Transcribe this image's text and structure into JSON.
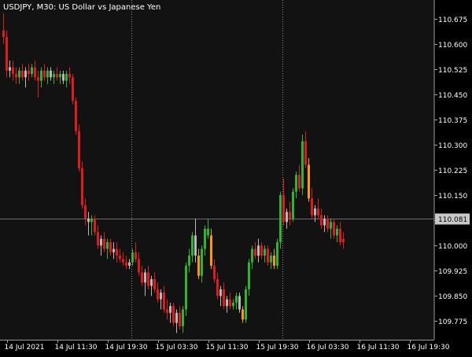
{
  "chart_data": {
    "type": "candlestick",
    "symbol": "USDJPY",
    "timeframe": "M30",
    "description": "US Dollar vs Japanese Yen",
    "current_price": "110.081",
    "current_price_value": 110.081,
    "ylim": [
      109.72,
      110.73
    ],
    "y_ticks": [
      "110.675",
      "110.600",
      "110.525",
      "110.450",
      "110.375",
      "110.300",
      "110.225",
      "110.150",
      "110.075",
      "110.000",
      "109.925",
      "109.850",
      "109.775"
    ],
    "y_tick_values": [
      110.675,
      110.6,
      110.525,
      110.45,
      110.375,
      110.3,
      110.225,
      110.15,
      110.075,
      110.0,
      109.925,
      109.85,
      109.775
    ],
    "x_ticks": [
      "14 Jul 2021",
      "14 Jul 11:30",
      "14 Jul 19:30",
      "15 Jul 03:30",
      "15 Jul 11:30",
      "15 Jul 19:30",
      "16 Jul 03:30",
      "16 Jul 11:30",
      "16 Jul 19:30"
    ],
    "x_tick_bars": [
      1,
      17,
      33,
      49,
      65,
      81,
      97,
      113,
      129
    ],
    "day_separators_at_bar": [
      40.5,
      88.5
    ],
    "colors": {
      "background": "#121212",
      "axis_bg": "#000000",
      "text": "#ffffff",
      "separator": "#8c8c8c",
      "price_line": "#8c8c8c",
      "bull": "#2fb52b",
      "bear": "#e01b1b",
      "neutral": "#b8b8b8",
      "highlight": "#ff9900",
      "price_box_bg": "#c8c8c8",
      "price_box_text": "#000000"
    },
    "candles": [
      [
        110.64,
        110.69,
        110.6,
        110.62,
        "bear"
      ],
      [
        110.62,
        110.64,
        110.5,
        110.52,
        "bear"
      ],
      [
        110.52,
        110.55,
        110.5,
        110.53,
        "neutral"
      ],
      [
        110.53,
        110.55,
        110.49,
        110.51,
        "bear"
      ],
      [
        110.51,
        110.53,
        110.48,
        110.5,
        "bear"
      ],
      [
        110.5,
        110.53,
        110.48,
        110.52,
        "bull"
      ],
      [
        110.52,
        110.54,
        110.49,
        110.5,
        "bear"
      ],
      [
        110.5,
        110.53,
        110.47,
        110.52,
        "neutral"
      ],
      [
        110.52,
        110.54,
        110.49,
        110.51,
        "bear"
      ],
      [
        110.51,
        110.54,
        110.5,
        110.53,
        "bull"
      ],
      [
        110.53,
        110.55,
        110.49,
        110.5,
        "bear"
      ],
      [
        110.5,
        110.52,
        110.44,
        110.49,
        "bear"
      ],
      [
        110.49,
        110.53,
        110.47,
        110.52,
        "bull"
      ],
      [
        110.52,
        110.54,
        110.49,
        110.5,
        "bear"
      ],
      [
        110.5,
        110.53,
        110.48,
        110.52,
        "bull"
      ],
      [
        110.52,
        110.53,
        110.49,
        110.5,
        "neutral"
      ],
      [
        110.5,
        110.52,
        110.48,
        110.51,
        "bull"
      ],
      [
        110.51,
        110.53,
        110.49,
        110.5,
        "bear"
      ],
      [
        110.5,
        110.52,
        110.48,
        110.51,
        "bull"
      ],
      [
        110.51,
        110.52,
        110.48,
        110.49,
        "neutral"
      ],
      [
        110.49,
        110.52,
        110.47,
        110.51,
        "bull"
      ],
      [
        110.51,
        110.53,
        110.48,
        110.5,
        "bear"
      ],
      [
        110.5,
        110.51,
        110.42,
        110.43,
        "bear"
      ],
      [
        110.43,
        110.44,
        110.33,
        110.34,
        "bear"
      ],
      [
        110.34,
        110.36,
        110.22,
        110.23,
        "bear"
      ],
      [
        110.23,
        110.25,
        110.11,
        110.12,
        "bear"
      ],
      [
        110.12,
        110.14,
        110.06,
        110.08,
        "bear"
      ],
      [
        110.08,
        110.1,
        110.03,
        110.07,
        "neutral"
      ],
      [
        110.07,
        110.09,
        110.03,
        110.08,
        "bull"
      ],
      [
        110.08,
        110.09,
        110.03,
        110.04,
        "bear"
      ],
      [
        110.04,
        110.06,
        109.99,
        110.0,
        "bear"
      ],
      [
        110.0,
        110.03,
        109.97,
        110.02,
        "neutral"
      ],
      [
        110.02,
        110.04,
        109.98,
        109.99,
        "bear"
      ],
      [
        109.99,
        110.02,
        109.96,
        110.01,
        "bull"
      ],
      [
        110.01,
        110.02,
        109.97,
        109.98,
        "bear"
      ],
      [
        109.98,
        110.01,
        109.96,
        109.99,
        "neutral"
      ],
      [
        109.99,
        110.01,
        109.95,
        109.97,
        "bear"
      ],
      [
        109.97,
        109.99,
        109.95,
        109.96,
        "bear"
      ],
      [
        109.96,
        109.98,
        109.94,
        109.95,
        "bear"
      ],
      [
        109.95,
        109.97,
        109.93,
        109.94,
        "bear"
      ],
      [
        109.94,
        109.96,
        109.93,
        109.95,
        "neutral"
      ],
      [
        109.95,
        109.99,
        109.94,
        109.98,
        "bull"
      ],
      [
        109.98,
        110.01,
        109.95,
        109.96,
        "bear"
      ],
      [
        109.96,
        109.98,
        109.91,
        109.92,
        "bear"
      ],
      [
        109.92,
        109.94,
        109.88,
        109.89,
        "bear"
      ],
      [
        109.89,
        109.93,
        109.85,
        109.92,
        "neutral"
      ],
      [
        109.92,
        109.94,
        109.87,
        109.88,
        "bear"
      ],
      [
        109.88,
        109.91,
        109.85,
        109.9,
        "neutral"
      ],
      [
        109.9,
        109.92,
        109.86,
        109.87,
        "bear"
      ],
      [
        109.87,
        109.89,
        109.83,
        109.84,
        "bear"
      ],
      [
        109.84,
        109.87,
        109.81,
        109.86,
        "neutral"
      ],
      [
        109.86,
        109.88,
        109.8,
        109.81,
        "bear"
      ],
      [
        109.81,
        109.84,
        109.78,
        109.8,
        "bear"
      ],
      [
        109.8,
        109.83,
        109.77,
        109.82,
        "neutral"
      ],
      [
        109.82,
        109.83,
        109.76,
        109.77,
        "bear"
      ],
      [
        109.77,
        109.81,
        109.74,
        109.8,
        "neutral"
      ],
      [
        109.8,
        109.82,
        109.75,
        109.76,
        "bear"
      ],
      [
        109.76,
        109.82,
        109.74,
        109.81,
        "bull"
      ],
      [
        109.81,
        109.95,
        109.79,
        109.94,
        "bull"
      ],
      [
        109.94,
        109.99,
        109.92,
        109.97,
        "bull"
      ],
      [
        109.97,
        110.04,
        109.95,
        110.03,
        "bull"
      ],
      [
        110.03,
        110.08,
        109.95,
        109.97,
        "neutral"
      ],
      [
        109.97,
        109.99,
        109.9,
        109.91,
        "highlight"
      ],
      [
        109.91,
        110.0,
        109.89,
        109.99,
        "bull"
      ],
      [
        109.99,
        110.06,
        109.97,
        110.05,
        "bull"
      ],
      [
        110.05,
        110.08,
        110.02,
        110.03,
        "bull"
      ],
      [
        110.03,
        110.05,
        109.93,
        109.94,
        "highlight"
      ],
      [
        109.94,
        109.96,
        109.89,
        109.9,
        "bear"
      ],
      [
        109.9,
        109.92,
        109.84,
        109.85,
        "bear"
      ],
      [
        109.85,
        109.88,
        109.82,
        109.87,
        "neutral"
      ],
      [
        109.87,
        109.89,
        109.81,
        109.82,
        "bear"
      ],
      [
        109.82,
        109.85,
        109.8,
        109.84,
        "neutral"
      ],
      [
        109.84,
        109.86,
        109.81,
        109.82,
        "bear"
      ],
      [
        109.82,
        109.84,
        109.81,
        109.83,
        "bull"
      ],
      [
        109.83,
        109.86,
        109.81,
        109.85,
        "bull"
      ],
      [
        109.85,
        109.86,
        109.8,
        109.81,
        "neutral"
      ],
      [
        109.81,
        109.82,
        109.77,
        109.78,
        "highlight"
      ],
      [
        109.78,
        109.88,
        109.77,
        109.87,
        "bull"
      ],
      [
        109.87,
        109.96,
        109.85,
        109.95,
        "bull"
      ],
      [
        109.95,
        110.0,
        109.93,
        109.99,
        "bull"
      ],
      [
        109.99,
        110.01,
        109.96,
        109.97,
        "bear"
      ],
      [
        109.97,
        110.02,
        109.95,
        110.0,
        "neutral"
      ],
      [
        110.0,
        110.01,
        109.96,
        109.97,
        "bear"
      ],
      [
        109.97,
        110.0,
        109.95,
        109.99,
        "bull"
      ],
      [
        109.99,
        110.0,
        109.94,
        109.95,
        "bear"
      ],
      [
        109.95,
        109.98,
        109.93,
        109.97,
        "bull"
      ],
      [
        109.97,
        109.99,
        109.93,
        109.94,
        "highlight"
      ],
      [
        109.94,
        110.02,
        109.93,
        110.01,
        "bull"
      ],
      [
        110.01,
        110.16,
        109.99,
        110.15,
        "bull"
      ],
      [
        110.15,
        110.2,
        110.06,
        110.07,
        "bear"
      ],
      [
        110.07,
        110.11,
        110.05,
        110.1,
        "neutral"
      ],
      [
        110.1,
        110.13,
        110.06,
        110.08,
        "bear"
      ],
      [
        110.08,
        110.17,
        110.07,
        110.16,
        "bull"
      ],
      [
        110.16,
        110.22,
        110.14,
        110.21,
        "bull"
      ],
      [
        110.21,
        110.24,
        110.16,
        110.17,
        "bear"
      ],
      [
        110.17,
        110.33,
        110.15,
        110.31,
        "bull"
      ],
      [
        110.31,
        110.34,
        110.23,
        110.24,
        "bear"
      ],
      [
        110.24,
        110.26,
        110.13,
        110.14,
        "highlight"
      ],
      [
        110.14,
        110.17,
        110.08,
        110.09,
        "bear"
      ],
      [
        110.09,
        110.12,
        110.07,
        110.11,
        "neutral"
      ],
      [
        110.11,
        110.14,
        110.08,
        110.09,
        "bear"
      ],
      [
        110.09,
        110.11,
        110.05,
        110.06,
        "bear"
      ],
      [
        110.06,
        110.09,
        110.04,
        110.08,
        "neutral"
      ],
      [
        110.08,
        110.09,
        110.04,
        110.05,
        "bear"
      ],
      [
        110.05,
        110.08,
        110.02,
        110.07,
        "bull"
      ],
      [
        110.07,
        110.08,
        110.02,
        110.03,
        "bear"
      ],
      [
        110.03,
        110.06,
        110.01,
        110.05,
        "bull"
      ],
      [
        110.05,
        110.07,
        110.0,
        110.01,
        "bear"
      ],
      [
        110.01,
        110.04,
        109.99,
        110.02,
        "bear"
      ]
    ]
  }
}
